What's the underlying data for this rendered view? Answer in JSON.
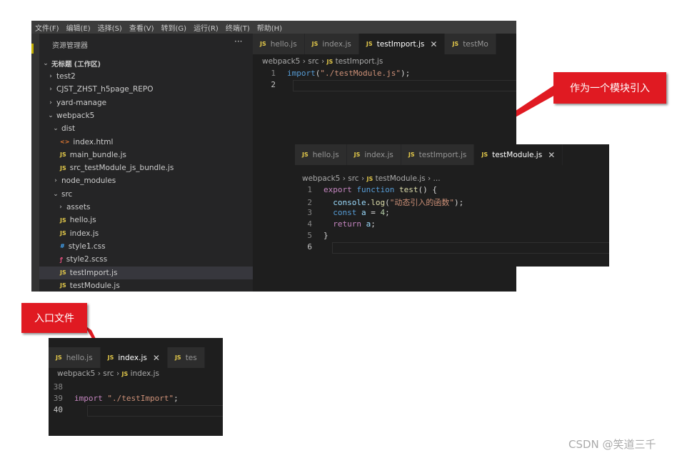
{
  "menubar": [
    "文件(F)",
    "编辑(E)",
    "选择(S)",
    "查看(V)",
    "转到(G)",
    "运行(R)",
    "终端(T)",
    "帮助(H)"
  ],
  "explorer": {
    "title": "资源管理器",
    "more": "···",
    "workspace": "无标题 (工作区)",
    "items": [
      {
        "label": "test2",
        "kind": "folder",
        "open": false,
        "indent": 1
      },
      {
        "label": "CJST_ZHST_h5page_REPO",
        "kind": "folder",
        "open": false,
        "indent": 1
      },
      {
        "label": "yard-manage",
        "kind": "folder",
        "open": false,
        "indent": 1
      },
      {
        "label": "webpack5",
        "kind": "folder",
        "open": true,
        "indent": 1
      },
      {
        "label": "dist",
        "kind": "folder",
        "open": true,
        "indent": 2
      },
      {
        "label": "index.html",
        "kind": "html",
        "indent": 3
      },
      {
        "label": "main_bundle.js",
        "kind": "js",
        "indent": 3
      },
      {
        "label": "src_testModule_js_bundle.js",
        "kind": "js",
        "indent": 3
      },
      {
        "label": "node_modules",
        "kind": "folder",
        "open": false,
        "indent": 2
      },
      {
        "label": "src",
        "kind": "folder",
        "open": true,
        "indent": 2
      },
      {
        "label": "assets",
        "kind": "folder",
        "open": false,
        "indent": 3
      },
      {
        "label": "hello.js",
        "kind": "js",
        "indent": 3
      },
      {
        "label": "index.js",
        "kind": "js",
        "indent": 3
      },
      {
        "label": "style1.css",
        "kind": "css",
        "indent": 3
      },
      {
        "label": "style2.scss",
        "kind": "scss",
        "indent": 3
      },
      {
        "label": "testImport.js",
        "kind": "js",
        "indent": 3,
        "selected": true
      },
      {
        "label": "testModule.js",
        "kind": "js",
        "indent": 3
      }
    ]
  },
  "editor1": {
    "tabs": [
      {
        "label": "hello.js",
        "active": false
      },
      {
        "label": "index.js",
        "active": false
      },
      {
        "label": "testImport.js",
        "active": true,
        "close": "✕"
      },
      {
        "label": "testMo",
        "active": false
      }
    ],
    "breadcrumb": {
      "a": "webpack5",
      "b": "src",
      "file": "testImport.js"
    },
    "lines": [
      {
        "n": "1",
        "parts": [
          [
            "kw2",
            "import"
          ],
          [
            "punc",
            "("
          ],
          [
            "str",
            "\"./testModule.js\""
          ],
          [
            "punc",
            ");"
          ]
        ]
      },
      {
        "n": "2",
        "parts": []
      }
    ]
  },
  "editor2": {
    "tabs": [
      {
        "label": "hello.js",
        "active": false
      },
      {
        "label": "index.js",
        "active": false
      },
      {
        "label": "testImport.js",
        "active": false
      },
      {
        "label": "testModule.js",
        "active": true,
        "close": "✕"
      }
    ],
    "breadcrumb": {
      "a": "webpack5",
      "b": "src",
      "file": "testModule.js",
      "more": "..."
    },
    "lines": [
      {
        "n": "1",
        "parts": [
          [
            "kw",
            "export "
          ],
          [
            "kw2",
            "function "
          ],
          [
            "fn",
            "test"
          ],
          [
            "punc",
            "() {"
          ]
        ]
      },
      {
        "n": "2",
        "parts": [
          [
            "var",
            "  console"
          ],
          [
            "punc",
            "."
          ],
          [
            "fn",
            "log"
          ],
          [
            "punc",
            "("
          ],
          [
            "str",
            "\"动态引入的函数\""
          ],
          [
            "punc",
            ");"
          ]
        ]
      },
      {
        "n": "3",
        "parts": [
          [
            "kw2",
            "  const "
          ],
          [
            "var",
            "a"
          ],
          [
            "punc",
            " = "
          ],
          [
            "num",
            "4"
          ],
          [
            "punc",
            ";"
          ]
        ]
      },
      {
        "n": "4",
        "parts": [
          [
            "kw",
            "  return "
          ],
          [
            "var",
            "a"
          ],
          [
            "punc",
            ";"
          ]
        ]
      },
      {
        "n": "5",
        "parts": [
          [
            "punc",
            "}"
          ]
        ]
      },
      {
        "n": "6",
        "parts": []
      }
    ]
  },
  "editor3": {
    "tabs": [
      {
        "label": "hello.js",
        "active": false
      },
      {
        "label": "index.js",
        "active": true,
        "close": "✕"
      },
      {
        "label": "tes",
        "active": false
      }
    ],
    "breadcrumb": {
      "a": "webpack5",
      "b": "src",
      "file": "index.js"
    },
    "lines": [
      {
        "n": "38",
        "parts": []
      },
      {
        "n": "39",
        "parts": [
          [
            "kw",
            "import "
          ],
          [
            "str",
            "\"./testImport\""
          ],
          [
            "punc",
            ";"
          ]
        ]
      },
      {
        "n": "40",
        "parts": []
      }
    ]
  },
  "callouts": {
    "module": "作为一个模块引入",
    "entry": "入口文件"
  },
  "watermark": "CSDN @笑道三千",
  "colors": {
    "callout": "#e01a22",
    "editor_bg": "#1e1e1e",
    "sidebar_bg": "#252526"
  }
}
